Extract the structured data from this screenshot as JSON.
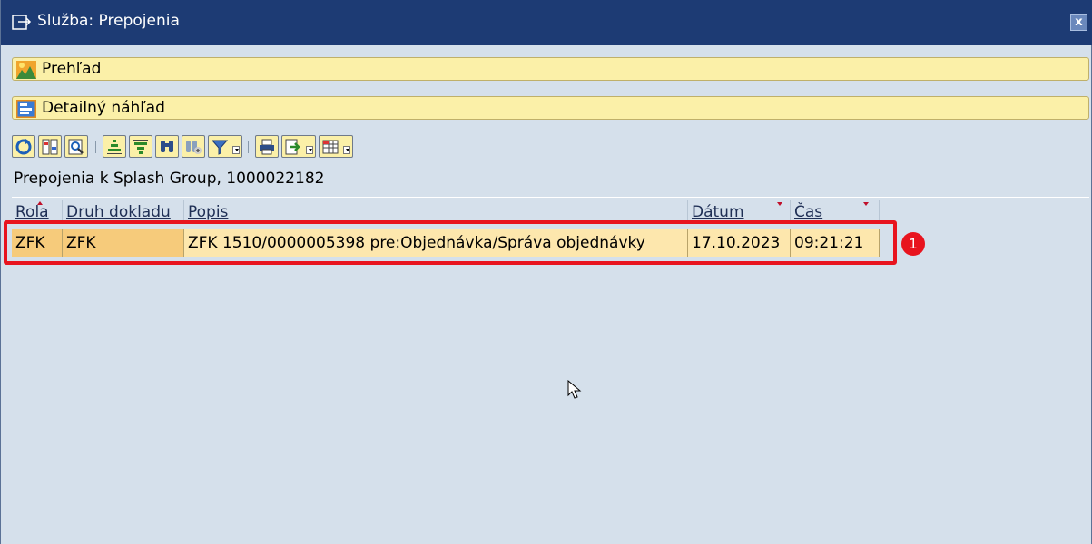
{
  "window": {
    "title": "Služba: Prepojenia",
    "close_label": "x"
  },
  "buttons": {
    "overview_label": "Prehľad",
    "detail_label": "Detailný náhľad"
  },
  "toolbar": {
    "icons": [
      "refresh-icon",
      "columns-icon",
      "magnifier-icon",
      "sort-ascending-icon",
      "sort-descending-icon",
      "find-icon",
      "find-next-icon",
      "filter-icon",
      "print-icon",
      "export-icon",
      "layout-icon"
    ]
  },
  "list": {
    "heading": "Prepojenia k Splash Group, 1000022182",
    "columns": [
      "Rola",
      "Druh dokladu",
      "Popis",
      "Dátum",
      "Čas"
    ],
    "rows": [
      {
        "rola": "ZFK",
        "druh": "ZFK",
        "popis": "ZFK 1510/0000005398 pre:Objednávka/Správa objednávky",
        "datum": "17.10.2023",
        "cas": "09:21:21"
      }
    ]
  },
  "annotation": {
    "badge": "1",
    "color": "#e8141e"
  },
  "colors": {
    "titlebar": "#1d3b74",
    "background": "#d5e0eb",
    "button": "#fbf0a8",
    "selected_row": "#f6cb7b"
  }
}
